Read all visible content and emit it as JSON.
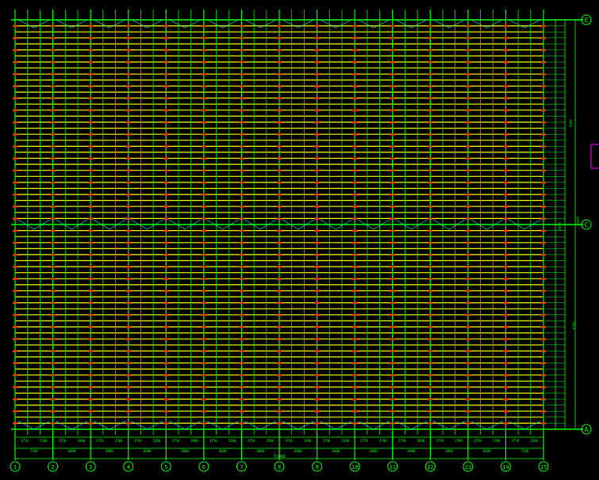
{
  "drawing": {
    "colors": {
      "background": "#000000",
      "grid": "#00ff00",
      "purlin": "#ffff00",
      "brace": "#00ffff",
      "marker": "#ff2a00",
      "accent": "#ff00ff"
    },
    "column_axes": [
      "1",
      "2",
      "3",
      "4",
      "5",
      "6",
      "7",
      "8",
      "9",
      "10",
      "11",
      "12",
      "13",
      "14",
      "15"
    ],
    "row_axes": [
      "A",
      "C",
      "E"
    ],
    "bottom_dims_row1": [
      "3750",
      "2500",
      "3750",
      "3600",
      "3750",
      "2500",
      "3750",
      "2500",
      "3750",
      "3600",
      "3750",
      "2500",
      "3750",
      "2500",
      "3750",
      "3600",
      "3750",
      "2500",
      "3750",
      "2500",
      "3750",
      "3600",
      "3750",
      "2500",
      "3750",
      "2500",
      "3750",
      "2500"
    ],
    "bottom_dims_row2": [
      "7500",
      "6000",
      "6000",
      "6000",
      "6000",
      "6000",
      "6000",
      "6000",
      "6000",
      "6000",
      "6000",
      "6000",
      "6000",
      "7500"
    ],
    "bottom_total": "71000",
    "right_dims": {
      "upper": "6000",
      "mid_a": "18000",
      "mid_b": "36000",
      "lower": "6000"
    }
  }
}
